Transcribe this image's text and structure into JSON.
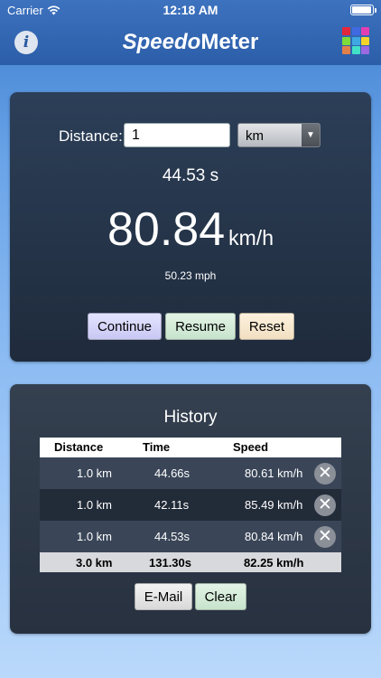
{
  "status_bar": {
    "carrier": "Carrier",
    "time": "12:18 AM"
  },
  "nav": {
    "title_part1": "Speedo",
    "title_part2": "Meter",
    "info_label": "i",
    "grid_colors": [
      "#e2283c",
      "#3f6ae2",
      "#e23fb4",
      "#7fdc3a",
      "#3fa8e2",
      "#f5d42a",
      "#e2804a",
      "#42e0c8",
      "#9a6ae2"
    ]
  },
  "measure": {
    "distance_label": "Distance:",
    "distance_value": "1",
    "unit": "km",
    "time": "44.53 s",
    "speed_value": "80.84",
    "speed_unit": "km/h",
    "speed_mph": "50.23 mph",
    "buttons": {
      "continue": "Continue",
      "resume": "Resume",
      "reset": "Reset"
    }
  },
  "history": {
    "title": "History",
    "columns": [
      "Distance",
      "Time",
      "Speed"
    ],
    "rows": [
      {
        "distance": "1.0 km",
        "time": "44.66s",
        "speed": "80.61 km/h"
      },
      {
        "distance": "1.0 km",
        "time": "42.11s",
        "speed": "85.49 km/h"
      },
      {
        "distance": "1.0 km",
        "time": "44.53s",
        "speed": "80.84 km/h"
      }
    ],
    "total": {
      "distance": "3.0 km",
      "time": "131.30s",
      "speed": "82.25 km/h"
    },
    "buttons": {
      "email": "E-Mail",
      "clear": "Clear"
    }
  }
}
